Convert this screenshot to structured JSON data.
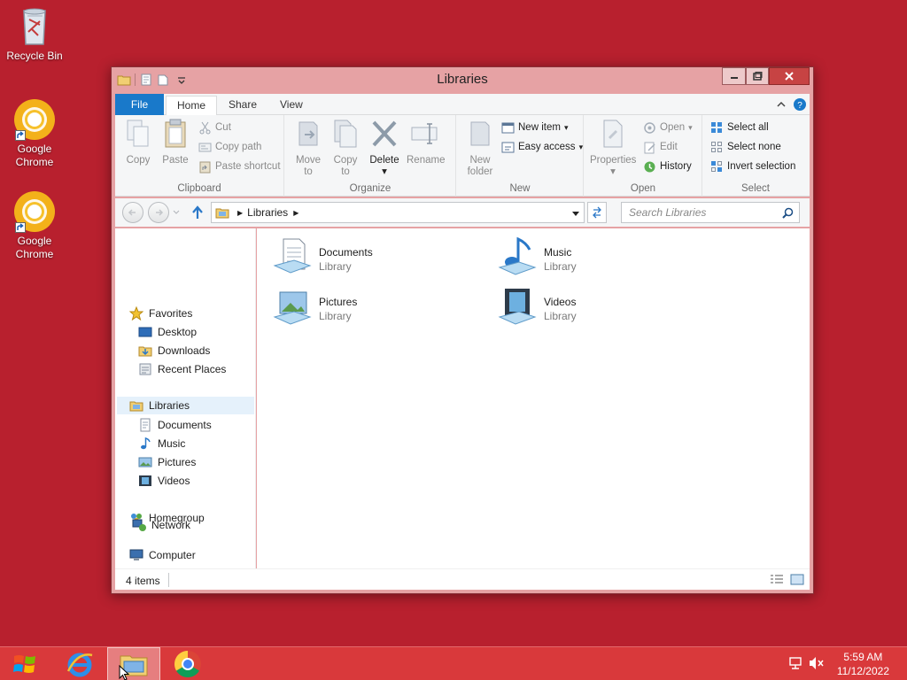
{
  "desktop": {
    "icons": [
      {
        "label": "Recycle Bin",
        "icon": "recycle-bin-icon"
      },
      {
        "label": "Google Chrome",
        "icon": "chrome-icon"
      },
      {
        "label": "Google Chrome",
        "icon": "chrome-icon"
      }
    ]
  },
  "window": {
    "title": "Libraries",
    "tabs": [
      {
        "label": "File"
      },
      {
        "label": "Home"
      },
      {
        "label": "Share"
      },
      {
        "label": "View"
      }
    ],
    "ribbon": {
      "clipboard": {
        "label": "Clipboard",
        "copy": "Copy",
        "paste": "Paste",
        "cut": "Cut",
        "copy_path": "Copy path",
        "paste_shortcut": "Paste shortcut"
      },
      "organize": {
        "label": "Organize",
        "move_to_1": "Move",
        "move_to_2": "to",
        "copy_to_1": "Copy",
        "copy_to_2": "to",
        "delete": "Delete",
        "rename": "Rename"
      },
      "new": {
        "label": "New",
        "new_folder_1": "New",
        "new_folder_2": "folder",
        "new_item": "New item",
        "easy_access": "Easy access"
      },
      "open": {
        "label": "Open",
        "properties": "Properties",
        "open": "Open",
        "edit": "Edit",
        "history": "History"
      },
      "select": {
        "label": "Select",
        "select_all": "Select all",
        "select_none": "Select none",
        "invert_selection": "Invert selection"
      }
    },
    "address": {
      "path": "Libraries",
      "search_placeholder": "Search Libraries"
    },
    "nav": {
      "favorites": "Favorites",
      "desktop": "Desktop",
      "downloads": "Downloads",
      "recent_places": "Recent Places",
      "libraries": "Libraries",
      "documents": "Documents",
      "music": "Music",
      "pictures": "Pictures",
      "videos": "Videos",
      "homegroup": "Homegroup",
      "computer": "Computer",
      "network": "Network"
    },
    "libraries": [
      {
        "name": "Documents",
        "type": "Library"
      },
      {
        "name": "Music",
        "type": "Library"
      },
      {
        "name": "Pictures",
        "type": "Library"
      },
      {
        "name": "Videos",
        "type": "Library"
      }
    ],
    "status": {
      "items": "4 items"
    }
  },
  "taskbar": {
    "time": "5:59 AM",
    "date": "11/12/2022"
  },
  "colors": {
    "desktop": "#b8202e",
    "taskbar": "#d9393b",
    "file_tab": "#1979ca"
  }
}
